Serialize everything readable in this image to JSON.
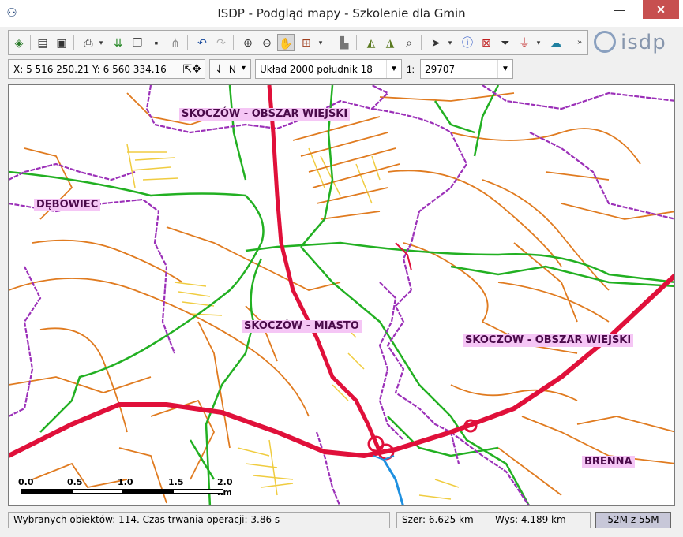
{
  "window": {
    "title": "ISDP - Podgląd mapy - Szkolenie dla Gmin",
    "minimize": "—",
    "maximize": "☐",
    "close": "✕"
  },
  "toolbar": {
    "icons": [
      "layers-icon",
      "properties-icon",
      "legend-icon",
      "print-icon",
      "export-icon",
      "copy-icon",
      "save-icon",
      "network-icon",
      "undo-icon",
      "redo-icon",
      "zoom-in-icon",
      "zoom-out-icon",
      "pan-hand-icon",
      "dropdown-icon",
      "terrain-icon",
      "select-layer-icon",
      "select-add-icon",
      "find-icon",
      "pointer-icon",
      "info-icon",
      "clear-selection-icon",
      "filter-icon",
      "remove-filter-icon",
      "cloud-icon",
      "more-icon"
    ]
  },
  "logo": {
    "text": "isdp"
  },
  "coords": {
    "text": "X: 5 516 250.21   Y: 6 560 334.16",
    "icon": "⇱✥"
  },
  "north": {
    "symbol": "⇃",
    "label": "N",
    "arrow": "▾"
  },
  "crs": {
    "value": "Układ 2000 południk 18",
    "arrow": "▼"
  },
  "scale": {
    "label": "1:",
    "value": "29707",
    "arrow": "▼"
  },
  "map": {
    "labels": [
      {
        "id": "skoczow-obszar-wiejski-north",
        "text": "SKOCZÓW - OBSZAR WIEJSKI"
      },
      {
        "id": "debowiec",
        "text": "DĘBOWIEC"
      },
      {
        "id": "skoczow-miasto",
        "text": "SKOCZÓW - MIASTO"
      },
      {
        "id": "skoczow-obszar-wiejski-east",
        "text": "SKOCZÓW - OBSZAR WIEJSKI"
      },
      {
        "id": "brenna",
        "text": "BRENNA"
      }
    ],
    "scalebar": {
      "ticks": [
        "0.0",
        "0.5",
        "1.0",
        "1.5",
        "2.0 km"
      ]
    },
    "colors": {
      "boundary": "#9b30b8",
      "green": "#22b022",
      "orange": "#e07b20",
      "yellow": "#f0cc40",
      "red": "#e0103a",
      "blue": "#1e90e0"
    }
  },
  "status": {
    "message": "Wybranych obiektów: 114. Czas trwania operacji: 3.86 s",
    "width": "Szer: 6.625 km",
    "height": "Wys: 4.189 km",
    "memory": "52M z 55M"
  }
}
